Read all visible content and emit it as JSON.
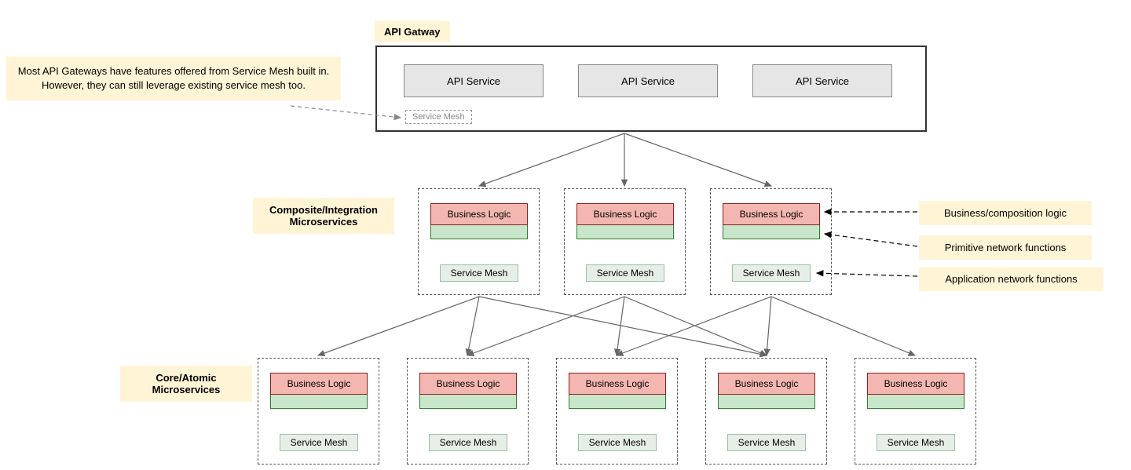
{
  "note": "Most API Gateways have features offered from Service Mesh built in. However, they can still leverage existing service mesh too.",
  "gateway": {
    "title": "API Gatway",
    "api_service": "API Service",
    "mesh_inline": "Service Mesh"
  },
  "labels": {
    "composite": "Composite/Integration Microservices",
    "core": "Core/Atomic Microservices",
    "legend_biz": "Business/composition logic",
    "legend_prim": "Primitive network functions",
    "legend_mesh": "Application network functions"
  },
  "micro": {
    "biz": "Business Logic",
    "mesh": "Service Mesh"
  }
}
